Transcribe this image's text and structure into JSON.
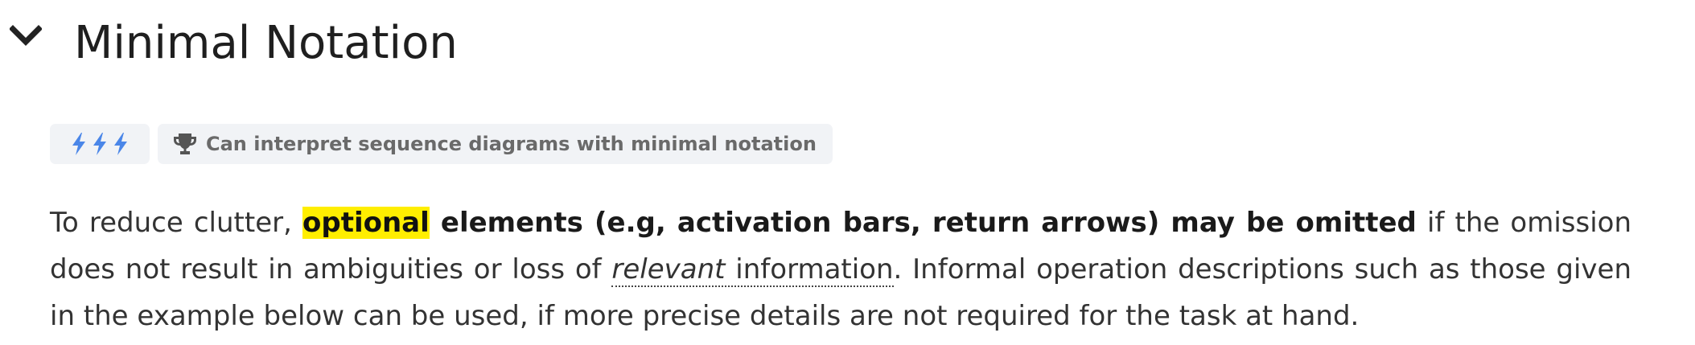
{
  "section": {
    "title": "Minimal Notation",
    "collapse_icon": "chevron-down-icon"
  },
  "badges": {
    "level_icon": "lightning-bolt-icon",
    "level_count": 3,
    "level_color": "#4a86e8",
    "skill_icon": "trophy-icon",
    "skill_text": "Can interpret sequence diagrams with minimal notation"
  },
  "paragraph": {
    "part1": "To reduce clutter, ",
    "highlight": "optional",
    "bold": " elements (e.g, activation bars, return arrows) may be omitted",
    "part2": " if the omission does not result in ambiguities or loss of ",
    "term_italic": "relevant",
    "term_rest": " information",
    "part3": ". Informal operation descriptions such as those given in the example below can be used, if more precise details are not required for the task at hand."
  },
  "colors": {
    "highlight": "#ffee00",
    "badge_background": "#f1f3f6",
    "badge_text": "#6a6a6a"
  }
}
